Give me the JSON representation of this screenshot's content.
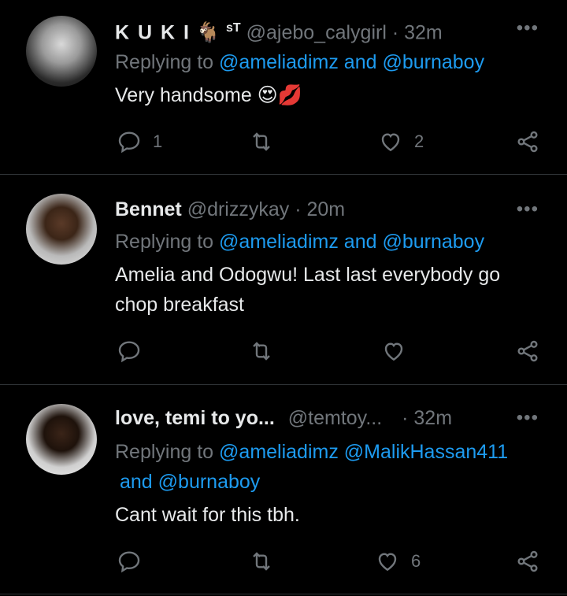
{
  "tweets": [
    {
      "name": "K U K I",
      "name_suffix": "sT",
      "handle": "@ajebo_calygirl",
      "time": "32m",
      "replying_prefix": "Replying to",
      "mentions_line1": "@ameliadimz and @burnaboy",
      "mentions_line2": "",
      "text": "Very handsome",
      "reply_count": "1",
      "retweet_count": "",
      "like_count": "2"
    },
    {
      "name": "Bennet",
      "handle": "@drizzykay",
      "time": "20m",
      "replying_prefix": "Replying to",
      "mentions_line1": "@ameliadimz and @burnaboy",
      "mentions_line2": "",
      "text": "Amelia and Odogwu! Last last everybody go chop breakfast",
      "reply_count": "",
      "retweet_count": "",
      "like_count": ""
    },
    {
      "name": "love, temi to yo...",
      "handle": "@temtoy...",
      "time": "32m",
      "replying_prefix": "Replying to",
      "mentions_line1": "@ameliadimz @MalikHassan411",
      "mentions_line2": "and @burnaboy",
      "text": "Cant wait for this tbh.",
      "reply_count": "",
      "retweet_count": "",
      "like_count": "6"
    }
  ],
  "ui": {
    "dot": "·",
    "more": "•••"
  },
  "colors": {
    "background": "#000000",
    "link": "#1d9bf0",
    "muted": "#71767b",
    "text": "#e7e9ea"
  }
}
